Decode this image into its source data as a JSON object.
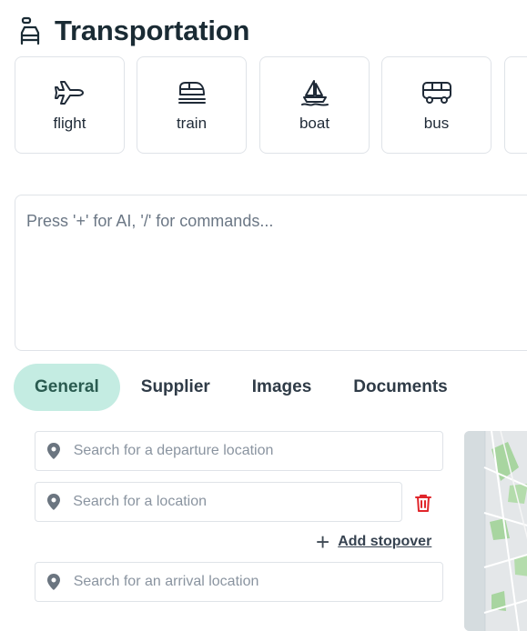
{
  "header": {
    "title": "Transportation",
    "icon": "car-icon"
  },
  "types": [
    {
      "label": "flight",
      "icon": "plane-icon"
    },
    {
      "label": "train",
      "icon": "train-icon"
    },
    {
      "label": "boat",
      "icon": "sailboat-icon"
    },
    {
      "label": "bus",
      "icon": "bus-icon"
    }
  ],
  "editor": {
    "placeholder": "Press '+' for AI, '/' for commands..."
  },
  "tabs": [
    {
      "label": "General",
      "active": true
    },
    {
      "label": "Supplier",
      "active": false
    },
    {
      "label": "Images",
      "active": false
    },
    {
      "label": "Documents",
      "active": false
    }
  ],
  "locations": {
    "departure_placeholder": "Search for a departure location",
    "stopover_placeholder": "Search for a location",
    "arrival_placeholder": "Search for an arrival location",
    "add_stopover_label": "Add stopover"
  },
  "colors": {
    "tab_active_bg": "#c4ece2",
    "delete_red": "#e0262b"
  }
}
